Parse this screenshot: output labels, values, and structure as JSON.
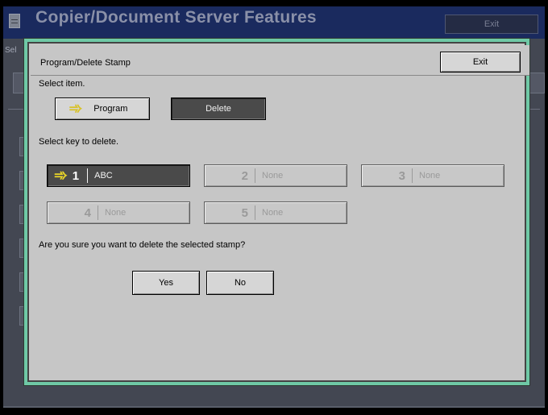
{
  "background": {
    "title": "Copier/Document Server Features",
    "exit_label": "Exit",
    "select_label_fragment": "Sel",
    "right_fragment": "s"
  },
  "dialog": {
    "title": "Program/Delete Stamp",
    "exit_label": "Exit",
    "select_item_label": "Select item.",
    "program_label": "Program",
    "delete_label": "Delete",
    "select_key_label": "Select key to delete.",
    "stamps": [
      {
        "number": "1",
        "name": "ABC",
        "selected": true
      },
      {
        "number": "2",
        "name": "None",
        "selected": false
      },
      {
        "number": "3",
        "name": "None",
        "selected": false
      },
      {
        "number": "4",
        "name": "None",
        "selected": false
      },
      {
        "number": "5",
        "name": "None",
        "selected": false
      }
    ],
    "confirm_text": "Are you sure you want to delete the selected stamp?",
    "yes_label": "Yes",
    "no_label": "No"
  },
  "colors": {
    "dialog_border": "#6fc9a6",
    "header_bg": "#1a2a5e",
    "selected_key_bg": "#4a4a4a",
    "arrow_yellow": "#e8d428"
  }
}
